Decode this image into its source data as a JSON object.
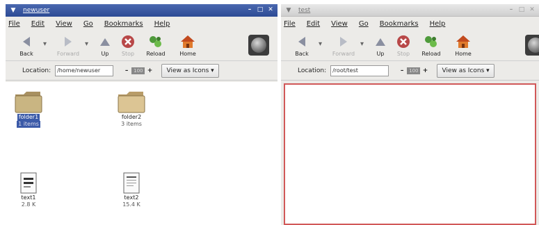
{
  "left_window": {
    "title": "newuser",
    "menu": [
      "File",
      "Edit",
      "View",
      "Go",
      "Bookmarks",
      "Help"
    ],
    "toolbar": {
      "back": "Back",
      "forward": "Forward",
      "up": "Up",
      "stop": "Stop",
      "reload": "Reload",
      "home": "Home"
    },
    "location_label": "Location:",
    "location_value": "/home/newuser",
    "zoom": "100",
    "view_mode": "View as Icons",
    "files": [
      {
        "name": "folder1",
        "meta": "1 items",
        "type": "folder",
        "selected": true
      },
      {
        "name": "folder2",
        "meta": "3 items",
        "type": "folder",
        "selected": false
      },
      {
        "name": "text1",
        "meta": "2.8 K",
        "type": "text",
        "selected": false
      },
      {
        "name": "text2",
        "meta": "15.4 K",
        "type": "text",
        "selected": false
      }
    ]
  },
  "right_window": {
    "title": "test",
    "menu": [
      "File",
      "Edit",
      "View",
      "Go",
      "Bookmarks",
      "Help"
    ],
    "toolbar": {
      "back": "Back",
      "forward": "Forward",
      "up": "Up",
      "stop": "Stop",
      "reload": "Reload",
      "home": "Home"
    },
    "location_label": "Location:",
    "location_value": "/root/test",
    "zoom": "100",
    "view_mode": "View as Icons"
  },
  "colors": {
    "title_active": "#2c4a94",
    "selection": "#3b5aa8",
    "drop_border": "#d15858",
    "folder": "#c9b582"
  },
  "icons": [
    "window-menu-icon",
    "minimize-icon",
    "maximize-icon",
    "close-icon",
    "back-icon",
    "forward-icon",
    "up-icon",
    "stop-icon",
    "reload-icon",
    "home-icon",
    "throbber-icon",
    "zoom-out-icon",
    "zoom-in-icon",
    "folder-icon",
    "text-file-icon",
    "dropdown-arrow-icon"
  ]
}
